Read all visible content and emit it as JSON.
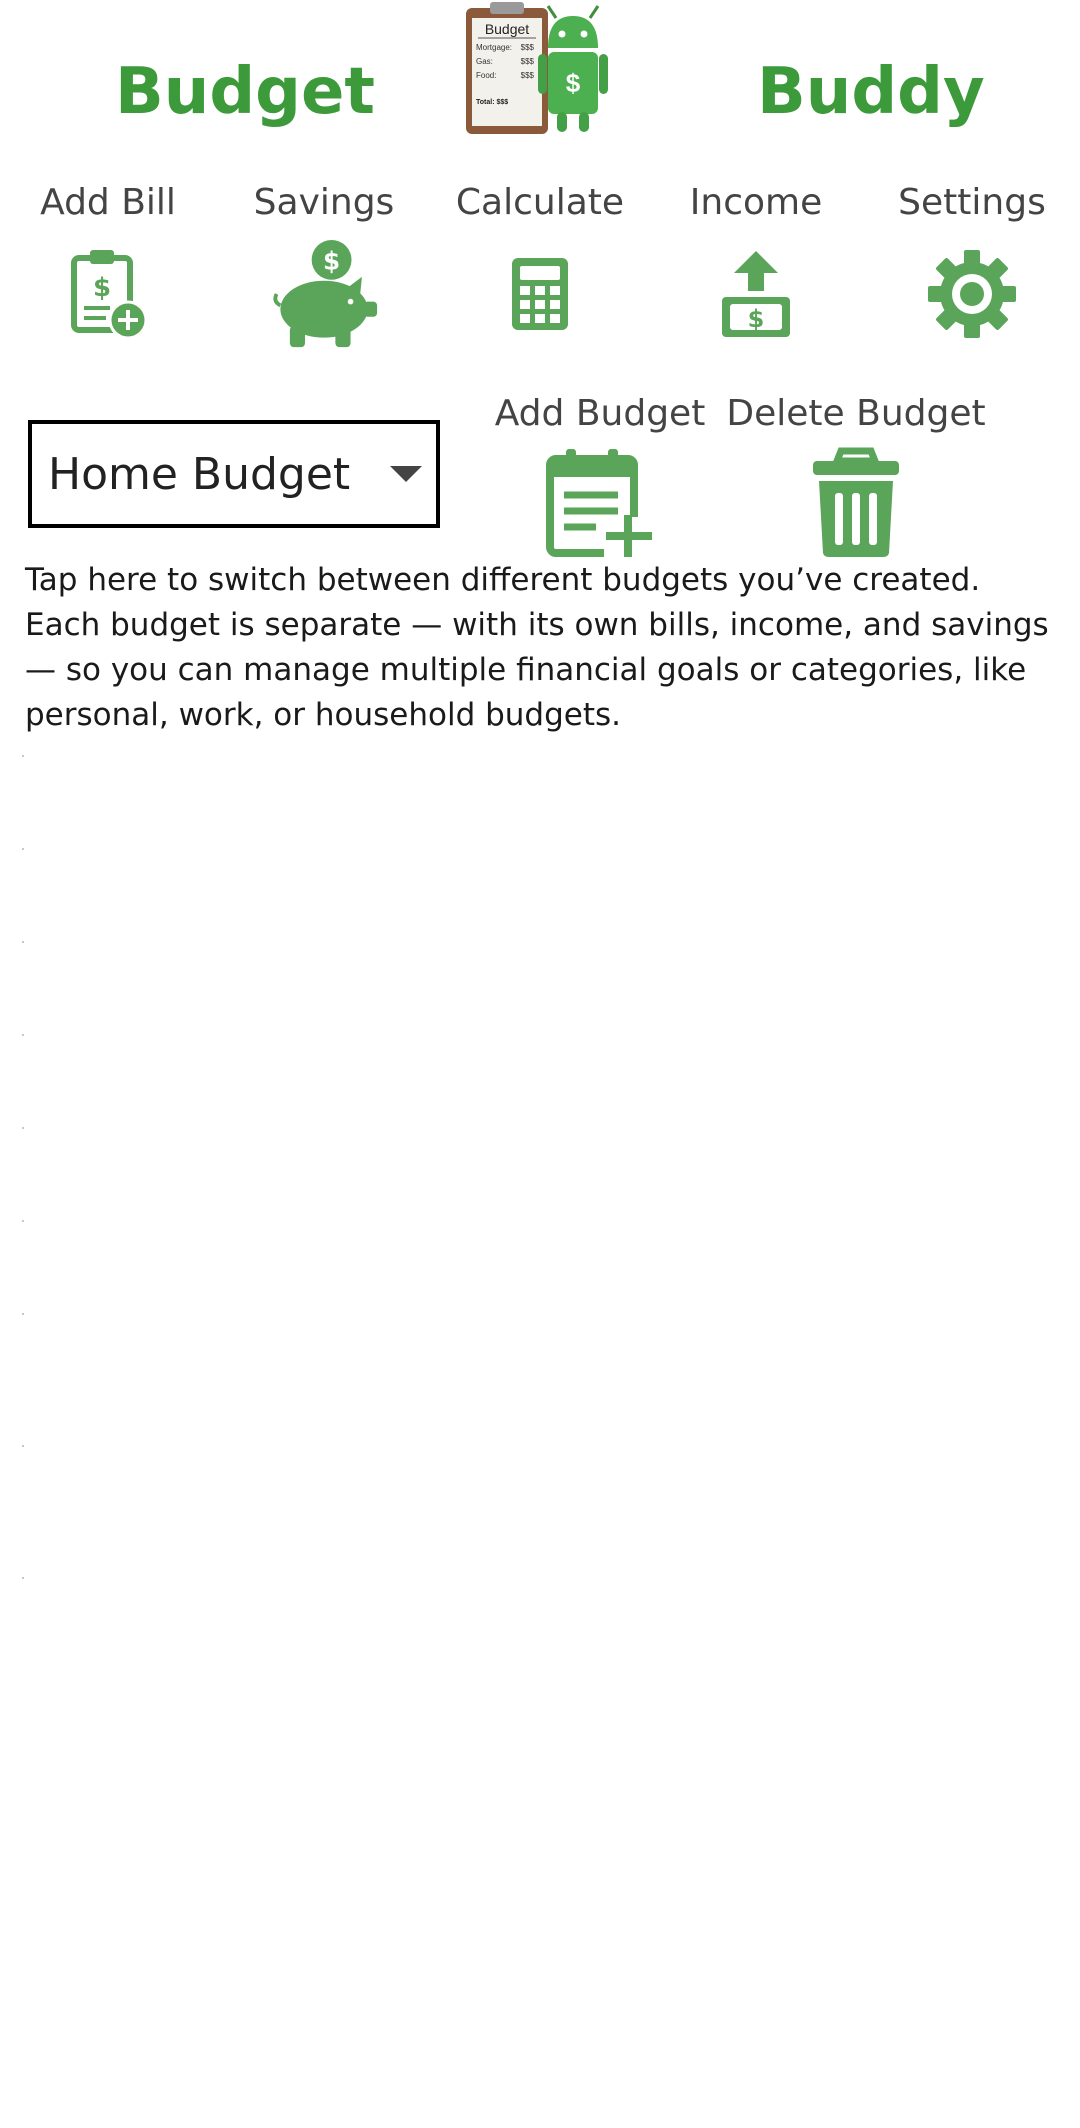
{
  "header": {
    "title_left": "Budget",
    "title_right": "Buddy",
    "logo": {
      "clipboard_title": "Budget",
      "lines": [
        {
          "label": "Mortgage:",
          "value": "$$$"
        },
        {
          "label": "Gas:",
          "value": "$$$"
        },
        {
          "label": "Food:",
          "value": "$$$"
        }
      ],
      "total": "Total: $$$",
      "robot_symbol": "$"
    }
  },
  "toolbar": {
    "items": [
      {
        "label": "Add Bill",
        "icon": "clipboard-add-icon"
      },
      {
        "label": "Savings",
        "icon": "piggy-bank-icon"
      },
      {
        "label": "Calculate",
        "icon": "calculator-icon"
      },
      {
        "label": "Income",
        "icon": "cash-upload-icon"
      },
      {
        "label": "Settings",
        "icon": "gear-icon"
      }
    ]
  },
  "budget": {
    "selected": "Home Budget",
    "add_label": "Add Budget",
    "delete_label": "Delete Budget"
  },
  "help_text": "Tap here to switch between different budgets you’ve created. Each budget is separate — with its own bills, income, and savings — so you can manage multiple financial goals or categories, like personal, work, or household budgets.",
  "colors": {
    "brand_green": "#3c9a3a",
    "icon_green": "#5aa55a"
  }
}
